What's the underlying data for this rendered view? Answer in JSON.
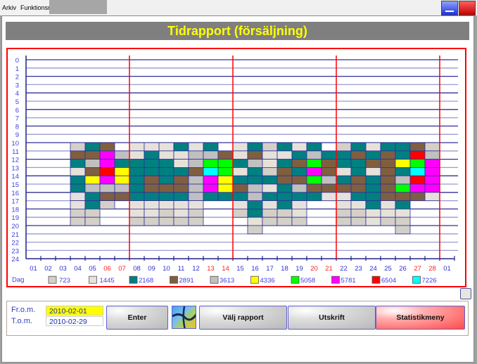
{
  "menu": {
    "items": [
      "Arkiv",
      "Funktionsmeny"
    ]
  },
  "window_buttons": {
    "minimize": "minimize-button",
    "close": "close-button"
  },
  "header": {
    "title": "Tidrapport (försäljning)"
  },
  "controls": {
    "from_label": "Fr.o.m.",
    "to_label": "T.o.m.",
    "from_value": "2010-02-01",
    "to_value": "2010-02-29",
    "enter_label": "Enter",
    "choose_report_label": "Välj rapport",
    "print_label": "Utskrift",
    "statistics_label": "Statistikmeny"
  },
  "colors": {
    "chart_border": "#ff0000",
    "week_separator": "#ff0000",
    "weekend_label": "#ff2020",
    "weekday_label": "#3030d0",
    "title_text": "#ffff00",
    "title_bg": "#7f7f7f"
  },
  "chart_data": {
    "type": "heatmap",
    "title": "Tidrapport (försäljning)",
    "xlabel": "Dag",
    "ylabel": "",
    "y_ticks": [
      "0",
      "1",
      "2",
      "3",
      "4",
      "5",
      "6",
      "7",
      "8",
      "9",
      "10",
      "11",
      "12",
      "13",
      "14",
      "15",
      "16",
      "17",
      "18",
      "19",
      "20",
      "21",
      "22",
      "23",
      "24"
    ],
    "x_ticks": [
      "01",
      "02",
      "03",
      "04",
      "05",
      "06",
      "07",
      "08",
      "09",
      "10",
      "11",
      "12",
      "13",
      "14",
      "15",
      "16",
      "17",
      "18",
      "19",
      "20",
      "21",
      "22",
      "23",
      "24",
      "25",
      "26",
      "27",
      "28",
      "01"
    ],
    "weekend_days": [
      "06",
      "07",
      "13",
      "14",
      "20",
      "21",
      "27",
      "28"
    ],
    "week_separators_after": [
      "07",
      "14",
      "21",
      "28"
    ],
    "legend": [
      {
        "value": 723,
        "color": "#d4d0c8"
      },
      {
        "value": 1445,
        "color": "#e6e2da"
      },
      {
        "value": 2168,
        "color": "#008080"
      },
      {
        "value": 2891,
        "color": "#7f5f3f"
      },
      {
        "value": 3613,
        "color": "#c0c0c0"
      },
      {
        "value": 4336,
        "color": "#ffff00"
      },
      {
        "value": 5058,
        "color": "#00ff00"
      },
      {
        "value": 5781,
        "color": "#ff00ff"
      },
      {
        "value": 6504,
        "color": "#ff0000"
      },
      {
        "value": 7226,
        "color": "#00ffff"
      }
    ],
    "cells_note": "each day maps hour -> legend value (hours 10..20)",
    "cells": {
      "04": {
        "10": 723,
        "11": 2891,
        "12": 2168,
        "13": 1445,
        "14": 2168,
        "15": 2168,
        "16": 1445,
        "17": 1445,
        "18": 723,
        "19": 723
      },
      "05": {
        "10": 2168,
        "11": 2891,
        "12": 3613,
        "13": 2891,
        "14": 4336,
        "15": 3613,
        "16": 2168,
        "17": 2168,
        "18": 723,
        "19": 723
      },
      "06": {
        "10": 2891,
        "11": 5781,
        "12": 5781,
        "13": 6504,
        "14": 5781,
        "15": 3613,
        "16": 2891,
        "17": 723
      },
      "07": {
        "11": 3613,
        "12": 2168,
        "13": 4336,
        "14": 4336,
        "15": 3613,
        "16": 2891
      },
      "08": {
        "10": 1445,
        "11": 1445,
        "12": 2168,
        "13": 2168,
        "14": 2168,
        "15": 2168,
        "16": 2168,
        "17": 1445,
        "18": 1445,
        "19": 723
      },
      "09": {
        "10": 1445,
        "11": 2168,
        "12": 2168,
        "13": 2168,
        "14": 2891,
        "15": 2891,
        "16": 2168,
        "17": 1445,
        "18": 1445,
        "19": 723
      },
      "10": {
        "10": 1445,
        "11": 1445,
        "12": 2168,
        "13": 2168,
        "14": 2168,
        "15": 2891,
        "16": 2168,
        "17": 1445,
        "18": 723,
        "19": 723
      },
      "11": {
        "10": 2168,
        "11": 1445,
        "12": 1445,
        "13": 2168,
        "14": 2891,
        "15": 2891,
        "16": 2168,
        "17": 1445,
        "18": 1445,
        "19": 723
      },
      "12": {
        "10": 1445,
        "11": 3613,
        "12": 3613,
        "13": 2891,
        "14": 3613,
        "15": 3613,
        "16": 3613,
        "17": 1445,
        "18": 723,
        "19": 723
      },
      "13": {
        "10": 2168,
        "11": 3613,
        "12": 5058,
        "13": 7226,
        "14": 5781,
        "15": 5781,
        "16": 2168
      },
      "14": {
        "11": 2891,
        "12": 5058,
        "13": 5058,
        "14": 4336,
        "15": 4336,
        "16": 2168
      },
      "15": {
        "10": 1445,
        "11": 1445,
        "12": 2168,
        "13": 1445,
        "14": 2168,
        "15": 2891,
        "16": 2168,
        "17": 1445,
        "18": 723
      },
      "16": {
        "10": 2168,
        "11": 2891,
        "12": 3613,
        "13": 2168,
        "14": 2168,
        "15": 3613,
        "16": 3613,
        "17": 2168,
        "18": 2168,
        "19": 1445,
        "20": 723
      },
      "17": {
        "10": 723,
        "11": 1445,
        "12": 1445,
        "13": 723,
        "14": 2168,
        "15": 1445,
        "16": 2168,
        "17": 1445,
        "18": 723,
        "19": 723
      },
      "18": {
        "10": 2168,
        "11": 1445,
        "12": 2168,
        "13": 2891,
        "14": 2891,
        "15": 2168,
        "16": 2168,
        "17": 2168,
        "18": 723,
        "19": 723
      },
      "19": {
        "10": 1445,
        "11": 2168,
        "12": 2891,
        "13": 2168,
        "14": 2891,
        "15": 3613,
        "16": 2168,
        "17": 1445,
        "18": 1445,
        "19": 723
      },
      "20": {
        "10": 2168,
        "11": 3613,
        "12": 5058,
        "13": 5781,
        "14": 5058,
        "15": 2891,
        "16": 2168
      },
      "21": {
        "11": 2168,
        "12": 2891,
        "13": 2891,
        "14": 3613,
        "15": 2891,
        "16": 1445
      },
      "22": {
        "10": 723,
        "11": 2168,
        "12": 2168,
        "13": 1445,
        "14": 2168,
        "15": 2891,
        "16": 1445,
        "17": 1445,
        "18": 723,
        "19": 723
      },
      "23": {
        "10": 2168,
        "11": 2891,
        "12": 2168,
        "13": 2168,
        "14": 2891,
        "15": 2891,
        "16": 2168,
        "17": 1445,
        "18": 723,
        "19": 723
      },
      "24": {
        "10": 1445,
        "11": 2168,
        "12": 2891,
        "13": 1445,
        "14": 2168,
        "15": 2168,
        "16": 2168,
        "17": 2168,
        "18": 1445,
        "19": 1445
      },
      "25": {
        "10": 2168,
        "11": 2891,
        "12": 2891,
        "13": 2891,
        "14": 2891,
        "15": 2891,
        "16": 2891,
        "17": 1445,
        "18": 1445,
        "19": 723
      },
      "26": {
        "10": 2168,
        "11": 2168,
        "12": 4336,
        "13": 2168,
        "14": 3613,
        "15": 5058,
        "16": 2891,
        "17": 2168,
        "18": 1445,
        "19": 723,
        "20": 723
      },
      "27": {
        "10": 2891,
        "11": 6504,
        "12": 5058,
        "13": 7226,
        "14": 6504,
        "15": 5781,
        "16": 2891
      },
      "28": {
        "10": 723,
        "11": 3613,
        "12": 5781,
        "13": 5781,
        "14": 5781,
        "15": 5781,
        "16": 1445
      }
    }
  }
}
